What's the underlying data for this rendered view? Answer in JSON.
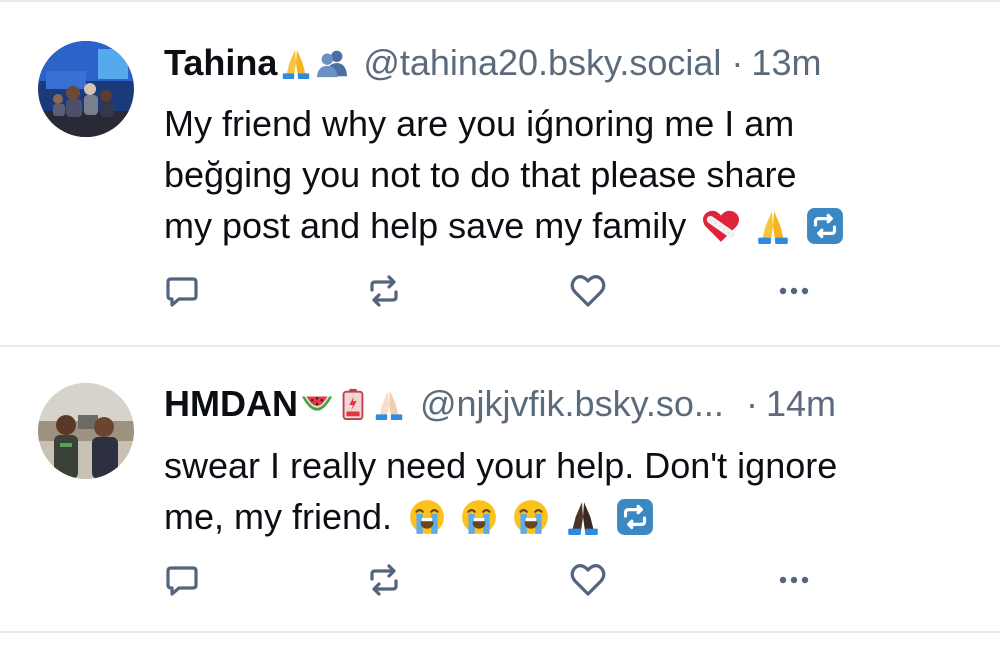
{
  "posts": [
    {
      "display_name": "Tahina",
      "name_emojis": [
        "folded-hands",
        "busts-in-silhouette"
      ],
      "handle": "@tahina20.bsky.social",
      "separator": "·",
      "time": "13m",
      "text_lines": [
        "My friend why are you iǵnoring me I am",
        "beğging you not to do that please share",
        "my post and help save my family"
      ],
      "trailing_emojis": [
        "mending-heart",
        "folded-hands",
        "repeat-button"
      ],
      "avatar_icon": "avatar-photo-group-indoor"
    },
    {
      "display_name": "HMDAN",
      "name_emojis": [
        "watermelon",
        "low-battery",
        "folded-hands-light"
      ],
      "handle": "@njkjvfik.bsky.so...",
      "separator": "·",
      "time": "14m",
      "text_lines": [
        "swear I really need your help. Don't ignore",
        "me, my friend."
      ],
      "trailing_emojis": [
        "loudly-crying-face",
        "loudly-crying-face",
        "loudly-crying-face",
        "folded-hands-dark",
        "repeat-button"
      ],
      "avatar_icon": "avatar-photo-two-men-outdoor"
    }
  ],
  "actions": {
    "reply_icon": "reply-icon",
    "repost_icon": "repost-icon",
    "like_icon": "heart-icon",
    "more_icon": "more-icon"
  },
  "colors": {
    "icon": "#52657c",
    "muted_text": "#5b6b7c",
    "text": "#0b0f14",
    "divider": "#e6e9ee"
  }
}
